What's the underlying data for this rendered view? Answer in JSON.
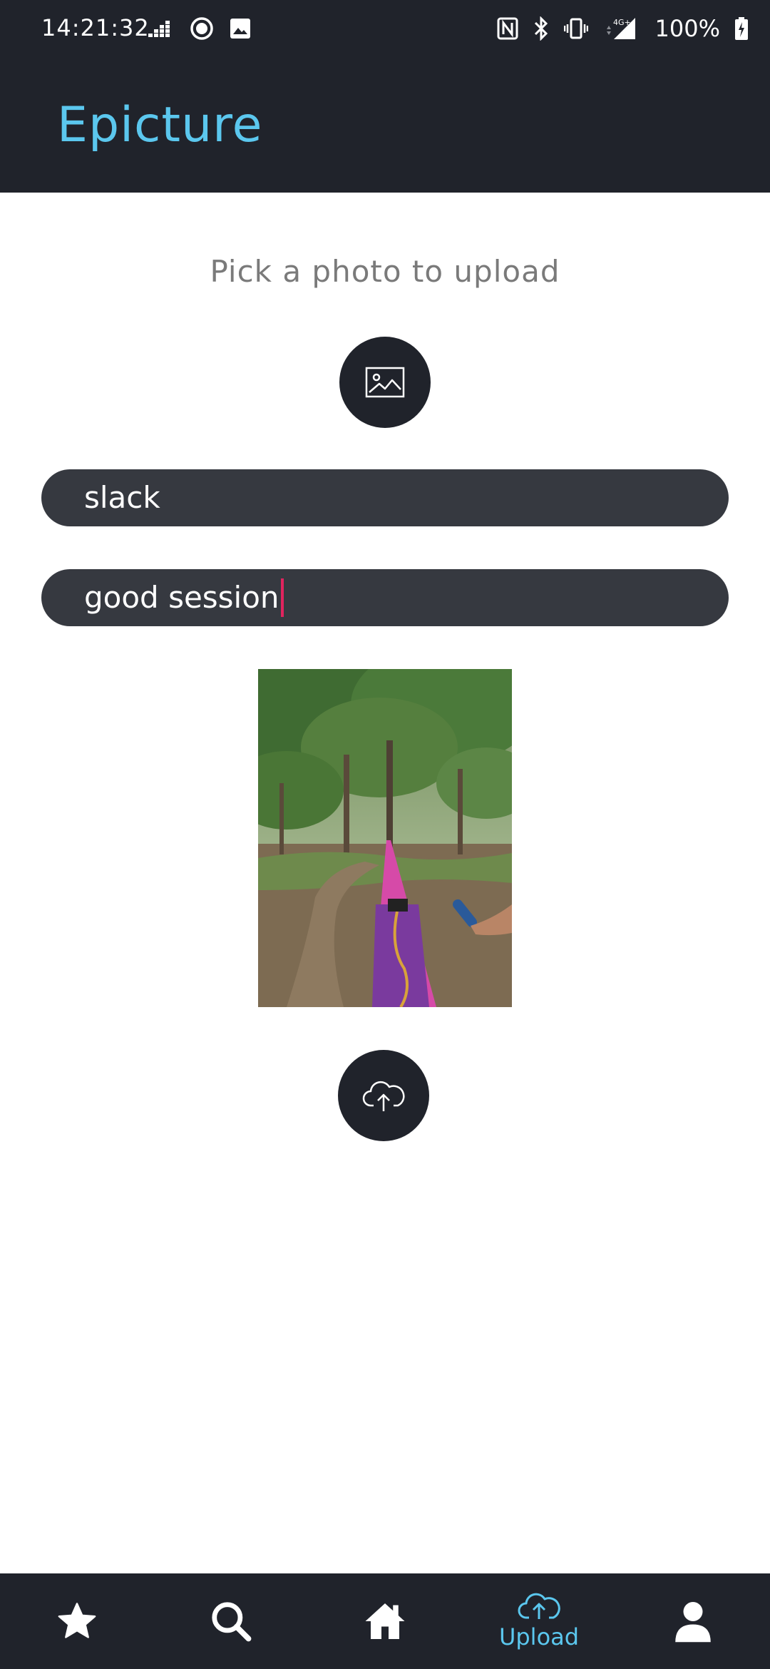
{
  "status_bar": {
    "time": "14:21:32",
    "battery": "100%",
    "network": "4G+"
  },
  "app_bar": {
    "title": "Epicture"
  },
  "upload_form": {
    "prompt": "Pick a photo to upload",
    "title_value": "slack",
    "description_value": "good session"
  },
  "bottom_nav": {
    "items": [
      {
        "icon": "star-icon",
        "label": ""
      },
      {
        "icon": "search-icon",
        "label": ""
      },
      {
        "icon": "home-icon",
        "label": ""
      },
      {
        "icon": "cloud-upload-icon",
        "label": "Upload",
        "active": true
      },
      {
        "icon": "account-icon",
        "label": ""
      }
    ]
  },
  "colors": {
    "bar_bg": "#20232b",
    "accent": "#5bc7ee",
    "field_bg": "#363940",
    "caret": "#e0245e"
  }
}
